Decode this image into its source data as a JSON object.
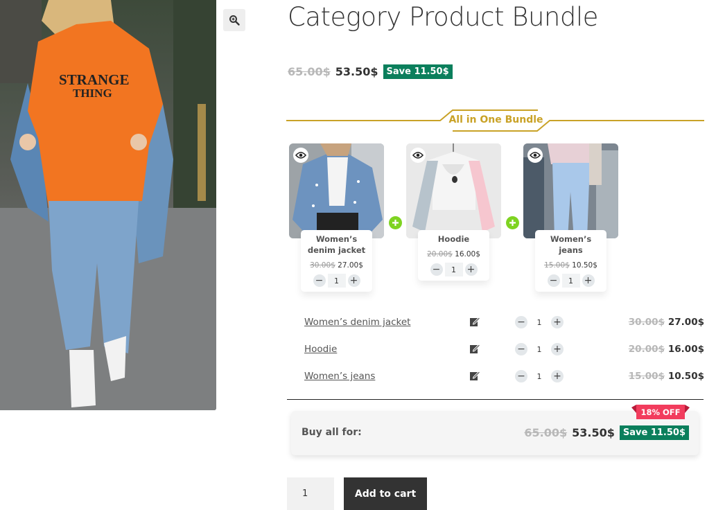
{
  "product": {
    "title": "Category Product Bundle",
    "price_old": "65.00$",
    "price_new": "53.50$",
    "save": "Save 11.50$"
  },
  "gallery": {
    "zoom_icon": "magnifier-icon"
  },
  "bundle": {
    "heading": "All in One Bundle",
    "accent_color": "#c9a227",
    "cards": [
      {
        "name": "Women’s denim jacket",
        "price_old": "30.00$",
        "price_new": "27.00$",
        "qty": "1"
      },
      {
        "name": "Hoodie",
        "price_old": "20.00$",
        "price_new": "16.00$",
        "qty": "1"
      },
      {
        "name": "Women’s jeans",
        "price_old": "15.00$",
        "price_new": "10.50$",
        "qty": "1"
      }
    ],
    "rows": [
      {
        "name": "Women’s denim jacket",
        "qty": "1",
        "price_old": "30.00$",
        "price_new": "27.00$"
      },
      {
        "name": "Hoodie",
        "qty": "1",
        "price_old": "20.00$",
        "price_new": "16.00$"
      },
      {
        "name": "Women’s jeans",
        "qty": "1",
        "price_old": "15.00$",
        "price_new": "10.50$"
      }
    ],
    "buy_all": {
      "label": "Buy all for:",
      "price_old": "65.00$",
      "price_new": "53.50$",
      "save": "Save 11.50$",
      "off_badge": "18% OFF"
    },
    "save_color": "#0b7f5c",
    "off_color": "#f23c5d",
    "plus_color": "#7ed321"
  },
  "cart": {
    "qty_value": "1",
    "add_label": "Add to cart"
  }
}
